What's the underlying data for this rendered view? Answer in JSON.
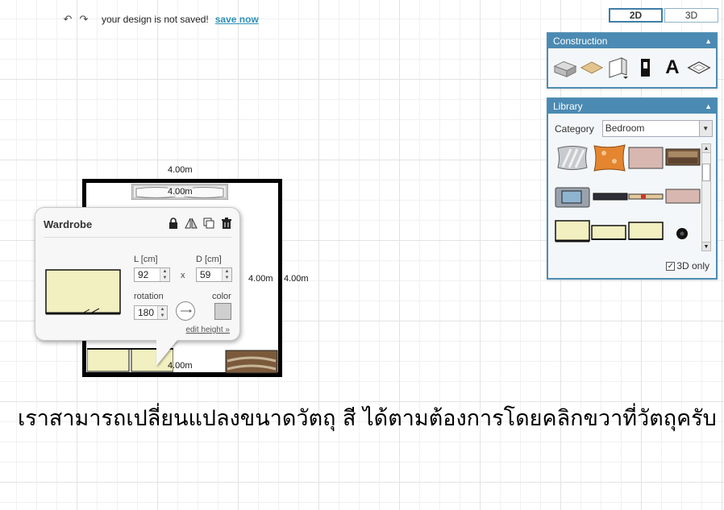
{
  "topbar": {
    "undo_icon": "undo-icon",
    "redo_icon": "redo-icon",
    "undo_glyph": "↶",
    "redo_glyph": "↷",
    "status": "your design is not saved!",
    "save_label": "save now"
  },
  "view_toggle": {
    "label_2d": "2D",
    "label_3d": "3D",
    "active": "2D"
  },
  "construction": {
    "title": "Construction",
    "tools": [
      "wall-tool-icon",
      "floor-tool-icon",
      "door-tool-icon",
      "window-tool-icon",
      "text-tool-icon",
      "dimension-tool-icon"
    ],
    "text_tool_glyph": "A"
  },
  "library": {
    "title": "Library",
    "category_label": "Category",
    "category_value": "Bedroom",
    "only3d_label": "3D only",
    "only3d_checked": true,
    "check_glyph": "✓"
  },
  "room": {
    "dim_top": "4.00m",
    "dim_bed": "4.00m",
    "dim_right_inner": "4.00m",
    "dim_right_outer": "4.00m",
    "dim_bottom": "4.00m"
  },
  "popup": {
    "title": "Wardrobe",
    "length_label": "L [cm]",
    "length_value": "92",
    "depth_label": "D [cm]",
    "depth_value": "59",
    "times_glyph": "x",
    "rotation_label": "rotation",
    "rotation_value": "180",
    "color_label": "color",
    "edit_height": "edit height »",
    "spin_up": "▲",
    "spin_down": "▼"
  },
  "caption": "เราสามารถเปลี่ยนแปลงขนาดวัตถุ สี ได้ตามต้องการโดยคลิกขวาที่วัตถุครับ",
  "colors": {
    "panel_header": "#4b8ab3",
    "link": "#2d8fb8",
    "item_cream": "#f2efc0"
  }
}
